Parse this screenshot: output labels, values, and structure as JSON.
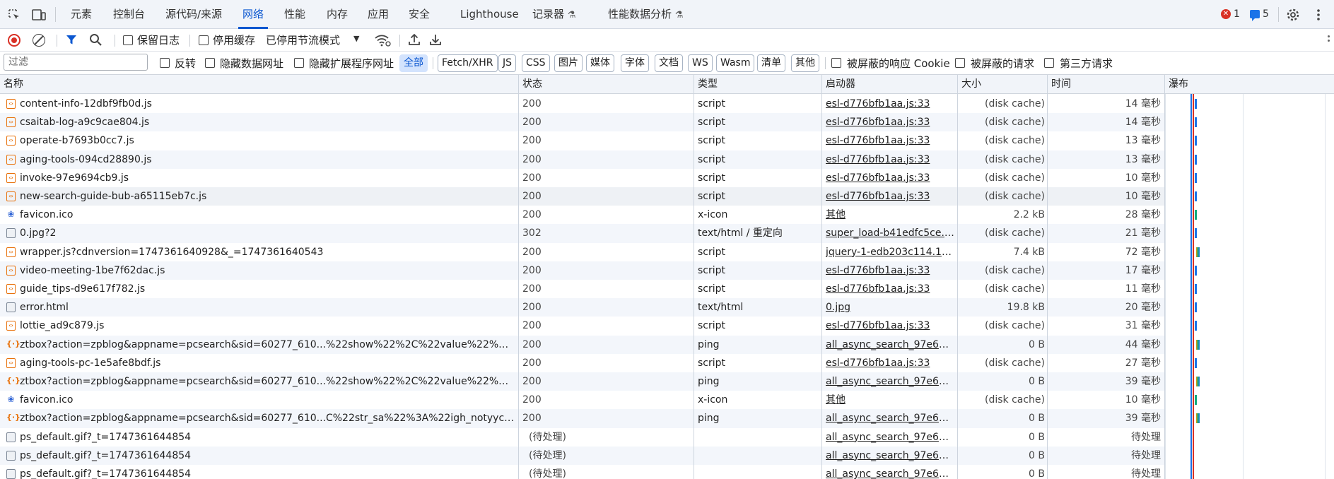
{
  "tabs": [
    {
      "label": "元素"
    },
    {
      "label": "控制台"
    },
    {
      "label": "源代码/来源"
    },
    {
      "label": "网络"
    },
    {
      "label": "性能"
    },
    {
      "label": "内存"
    },
    {
      "label": "应用"
    },
    {
      "label": "安全"
    },
    {
      "label": "Lighthouse"
    },
    {
      "label": "记录器"
    },
    {
      "label": "性能数据分析"
    }
  ],
  "active_tab": "网络",
  "status": {
    "errors": "1",
    "messages": "5"
  },
  "toolbar": {
    "preserve_log": "保留日志",
    "disable_cache": "停用缓存",
    "throttling": "已停用节流模式"
  },
  "filter": {
    "placeholder": "过滤",
    "invert": "反转",
    "hide_data_urls": "隐藏数据网址",
    "hide_ext_urls": "隐藏扩展程序网址",
    "types": [
      "全部",
      "Fetch/XHR",
      "JS",
      "CSS",
      "图片",
      "媒体",
      "字体",
      "文档",
      "WS",
      "Wasm",
      "清单",
      "其他"
    ],
    "blocked_cookies": "被屏蔽的响应 Cookie",
    "blocked_requests": "被屏蔽的请求",
    "third_party": "第三方请求"
  },
  "columns": {
    "name": "名称",
    "status": "状态",
    "type": "类型",
    "initiator": "启动器",
    "size": "大小",
    "time": "时间",
    "waterfall": "瀑布"
  },
  "rows": [
    {
      "icon": "script",
      "name": "content-info-12dbf9fb0d.js",
      "status": "200",
      "type": "script",
      "initiator": "esl-d776bfb1aa.js:33",
      "size": "(disk cache)",
      "time": "14 毫秒"
    },
    {
      "icon": "script",
      "name": "csaitab-log-a9c9cae804.js",
      "status": "200",
      "type": "script",
      "initiator": "esl-d776bfb1aa.js:33",
      "size": "(disk cache)",
      "time": "14 毫秒"
    },
    {
      "icon": "script",
      "name": "operate-b7693b0cc7.js",
      "status": "200",
      "type": "script",
      "initiator": "esl-d776bfb1aa.js:33",
      "size": "(disk cache)",
      "time": "13 毫秒"
    },
    {
      "icon": "script",
      "name": "aging-tools-094cd28890.js",
      "status": "200",
      "type": "script",
      "initiator": "esl-d776bfb1aa.js:33",
      "size": "(disk cache)",
      "time": "13 毫秒"
    },
    {
      "icon": "script",
      "name": "invoke-97e9694cb9.js",
      "status": "200",
      "type": "script",
      "initiator": "esl-d776bfb1aa.js:33",
      "size": "(disk cache)",
      "time": "10 毫秒"
    },
    {
      "icon": "script",
      "name": "new-search-guide-bub-a65115eb7c.js",
      "status": "200",
      "type": "script",
      "initiator": "esl-d776bfb1aa.js:33",
      "size": "(disk cache)",
      "time": "10 毫秒"
    },
    {
      "icon": "fav",
      "name": "favicon.ico",
      "status": "200",
      "type": "x-icon",
      "initiator": "其他",
      "size": "2.2 kB",
      "time": "28 毫秒"
    },
    {
      "icon": "doc",
      "name": "0.jpg?2",
      "status": "302",
      "type": "text/html / 重定向",
      "initiator": "super_load-b41edfc5ce.js...",
      "size": "(disk cache)",
      "time": "21 毫秒"
    },
    {
      "icon": "script",
      "name": "wrapper.js?cdnversion=1747361640928&_=1747361640543",
      "status": "200",
      "type": "script",
      "initiator": "jquery-1-edb203c114.10....",
      "size": "7.4 kB",
      "time": "72 毫秒"
    },
    {
      "icon": "script",
      "name": "video-meeting-1be7f62dac.js",
      "status": "200",
      "type": "script",
      "initiator": "esl-d776bfb1aa.js:33",
      "size": "(disk cache)",
      "time": "17 毫秒"
    },
    {
      "icon": "script",
      "name": "guide_tips-d9e617f782.js",
      "status": "200",
      "type": "script",
      "initiator": "esl-d776bfb1aa.js:33",
      "size": "(disk cache)",
      "time": "11 毫秒"
    },
    {
      "icon": "doc",
      "name": "error.html",
      "status": "200",
      "type": "text/html",
      "initiator": "0.jpg",
      "size": "19.8 kB",
      "time": "20 毫秒"
    },
    {
      "icon": "script",
      "name": "lottie_ad9c879.js",
      "status": "200",
      "type": "script",
      "initiator": "esl-d776bfb1aa.js:33",
      "size": "(disk cache)",
      "time": "31 毫秒"
    },
    {
      "icon": "ping",
      "name": "ztbox?action=zpblog&appname=pcsearch&sid=60277_610...%22show%22%2C%22value%22%3A%22c...",
      "status": "200",
      "type": "ping",
      "initiator": "all_async_search_97e649...",
      "size": "0 B",
      "time": "44 毫秒"
    },
    {
      "icon": "script",
      "name": "aging-tools-pc-1e5afe8bdf.js",
      "status": "200",
      "type": "script",
      "initiator": "esl-d776bfb1aa.js:33",
      "size": "(disk cache)",
      "time": "27 毫秒"
    },
    {
      "icon": "ping",
      "name": "ztbox?action=zpblog&appname=pcsearch&sid=60277_610...%22show%22%2C%22value%22%3A%22ai...",
      "status": "200",
      "type": "ping",
      "initiator": "all_async_search_97e649...",
      "size": "0 B",
      "time": "39 毫秒"
    },
    {
      "icon": "fav",
      "name": "favicon.ico",
      "status": "200",
      "type": "x-icon",
      "initiator": "其他",
      "size": "(disk cache)",
      "time": "10 毫秒"
    },
    {
      "icon": "ping",
      "name": "ztbox?action=zpblog&appname=pcsearch&sid=60277_610...C%22str_sa%22%3A%22igh_notyyc_gsnd...",
      "status": "200",
      "type": "ping",
      "initiator": "all_async_search_97e649...",
      "size": "0 B",
      "time": "39 毫秒"
    },
    {
      "icon": "doc",
      "name": "ps_default.gif?_t=1747361644854",
      "status": "(待处理)",
      "type": "",
      "initiator": "all_async_search_97e649...",
      "size": "0 B",
      "time": "待处理"
    },
    {
      "icon": "doc",
      "name": "ps_default.gif?_t=1747361644854",
      "status": "(待处理)",
      "type": "",
      "initiator": "all_async_search_97e649...",
      "size": "0 B",
      "time": "待处理"
    },
    {
      "icon": "doc",
      "name": "ps_default.gif?_t=1747361644854",
      "status": "(待处理)",
      "type": "",
      "initiator": "all_async_search_97e649...",
      "size": "0 B",
      "time": "待处理"
    }
  ],
  "colors": {
    "accent": "#0b57d0",
    "record": "#d93025",
    "waterfall_blue": "#1a73e8",
    "waterfall_red": "#d93025"
  }
}
